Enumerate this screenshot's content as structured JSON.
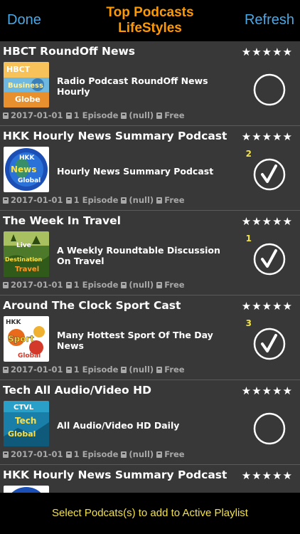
{
  "nav": {
    "done_label": "Done",
    "refresh_label": "Refresh",
    "title_line1": "Top Podcasts",
    "title_line2": "LifeStyles"
  },
  "colors": {
    "background": "#383838",
    "nav_link": "#4aa8e6",
    "title": "#ff9900",
    "order_number": "#f2e24a",
    "meta_text": "#a8a8a8"
  },
  "podcasts": [
    {
      "title": "HBCT RoundOff News",
      "rating": "★★★★★",
      "thumbnail_text": [
        "HBCT",
        "Business",
        "Globe"
      ],
      "description": "Radio Podcast RoundOff News Hourly",
      "date": "2017-01-01",
      "episodes": "1 Episode",
      "size": "(null)",
      "price": "Free",
      "selected": false,
      "order": ""
    },
    {
      "title": "HKK Hourly News Summary Podcast",
      "rating": "★★★★★",
      "thumbnail_text": [
        "HKK",
        "News",
        "Global"
      ],
      "description": "Hourly News Summary Podcast",
      "date": "2017-01-01",
      "episodes": "1 Episode",
      "size": "(null)",
      "price": "Free",
      "selected": true,
      "order": "2"
    },
    {
      "title": "The Week In Travel",
      "rating": "★★★★★",
      "thumbnail_text": [
        "Live",
        "Destination",
        "Travel"
      ],
      "description": "A Weekly Roundtable Discussion On Travel",
      "date": "2017-01-01",
      "episodes": "1 Episode",
      "size": "(null)",
      "price": "Free",
      "selected": true,
      "order": "1"
    },
    {
      "title": "Around The Clock Sport Cast",
      "rating": "★★★★★",
      "thumbnail_text": [
        "HKK",
        "Sport",
        "Global"
      ],
      "description": "Many Hottest Sport Of The Day News",
      "date": "2017-01-01",
      "episodes": "1 Episode",
      "size": "(null)",
      "price": "Free",
      "selected": true,
      "order": "3"
    },
    {
      "title": "Tech All Audio/Video HD",
      "rating": "★★★★★",
      "thumbnail_text": [
        "CTVL",
        "Tech",
        "Global"
      ],
      "description": "All Audio/Video HD Daily",
      "date": "2017-01-01",
      "episodes": "1 Episode",
      "size": "(null)",
      "price": "Free",
      "selected": false,
      "order": ""
    },
    {
      "title": "HKK Hourly News Summary Podcast",
      "rating": "★★★★★"
    }
  ],
  "footer": {
    "text": "Select Podcats(s) to add to Active Playlist"
  }
}
